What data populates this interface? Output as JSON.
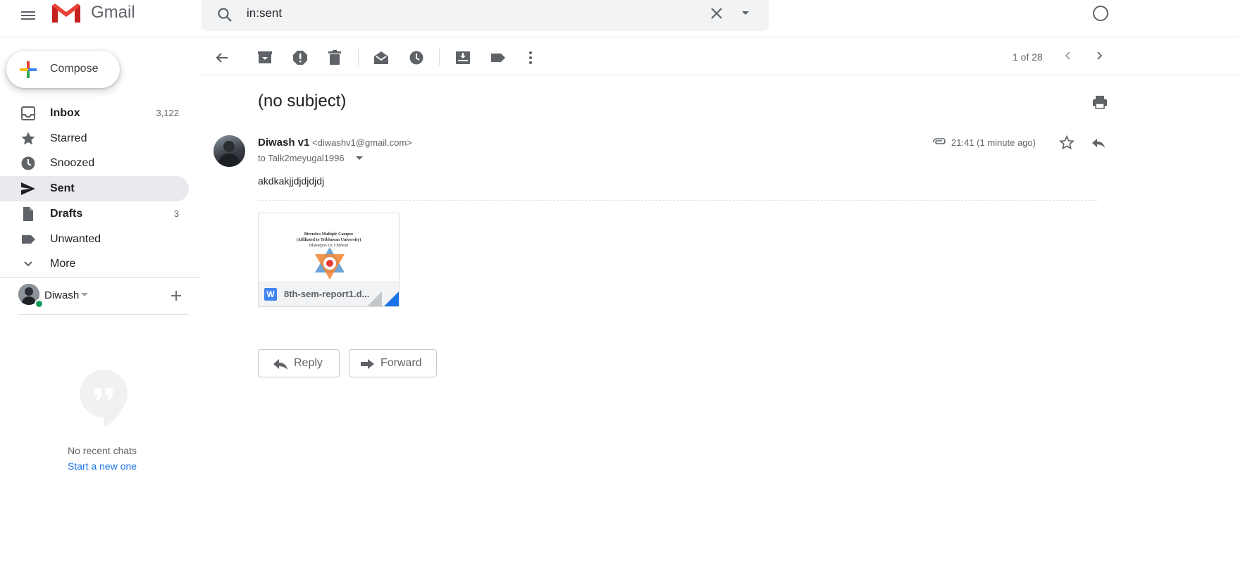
{
  "app": {
    "name": "Gmail"
  },
  "search": {
    "value": "in:sent"
  },
  "compose": {
    "label": "Compose"
  },
  "sidebar": {
    "items": [
      {
        "label": "Inbox",
        "count": "3,122",
        "bold": true,
        "icon": "inbox-icon"
      },
      {
        "label": "Starred",
        "count": "",
        "bold": false,
        "icon": "star-icon"
      },
      {
        "label": "Snoozed",
        "count": "",
        "bold": false,
        "icon": "clock-icon"
      },
      {
        "label": "Sent",
        "count": "",
        "bold": true,
        "icon": "send-icon",
        "active": true
      },
      {
        "label": "Drafts",
        "count": "3",
        "bold": true,
        "icon": "draft-icon"
      },
      {
        "label": "Unwanted",
        "count": "",
        "bold": false,
        "icon": "label-icon"
      },
      {
        "label": "More",
        "count": "",
        "bold": false,
        "icon": "chevron-down-icon"
      }
    ]
  },
  "hangouts": {
    "user_name": "Diwash",
    "empty_text": "No recent chats",
    "start_link": "Start a new one"
  },
  "toolbar": {
    "pager": "1 of 28",
    "icons": [
      "back-icon",
      "archive-icon",
      "report-spam-icon",
      "delete-icon",
      "mark-unread-icon",
      "snooze-icon",
      "move-to-icon",
      "label-icon",
      "more-vert-icon"
    ]
  },
  "message": {
    "subject": "(no subject)",
    "sender_name": "Diwash v1",
    "sender_email": "<diwashv1@gmail.com>",
    "to_line": "to Talk2meyugal1996",
    "time": "21:41 (1 minute ago)",
    "body": "akdkakjjdjdjdjdj"
  },
  "attachment": {
    "file_name": "8th-sem-report1.d...",
    "thumb_lines": [
      "Birendra Multiple Campus",
      "(Affiliated to Tribhuvan University)",
      "Bharatpur-10, Chitwan"
    ]
  },
  "actions": {
    "reply": "Reply",
    "forward": "Forward"
  },
  "colors": {
    "active_nav": "#e8eaed",
    "link": "#1a73e8",
    "presence": "#0f9d58"
  }
}
